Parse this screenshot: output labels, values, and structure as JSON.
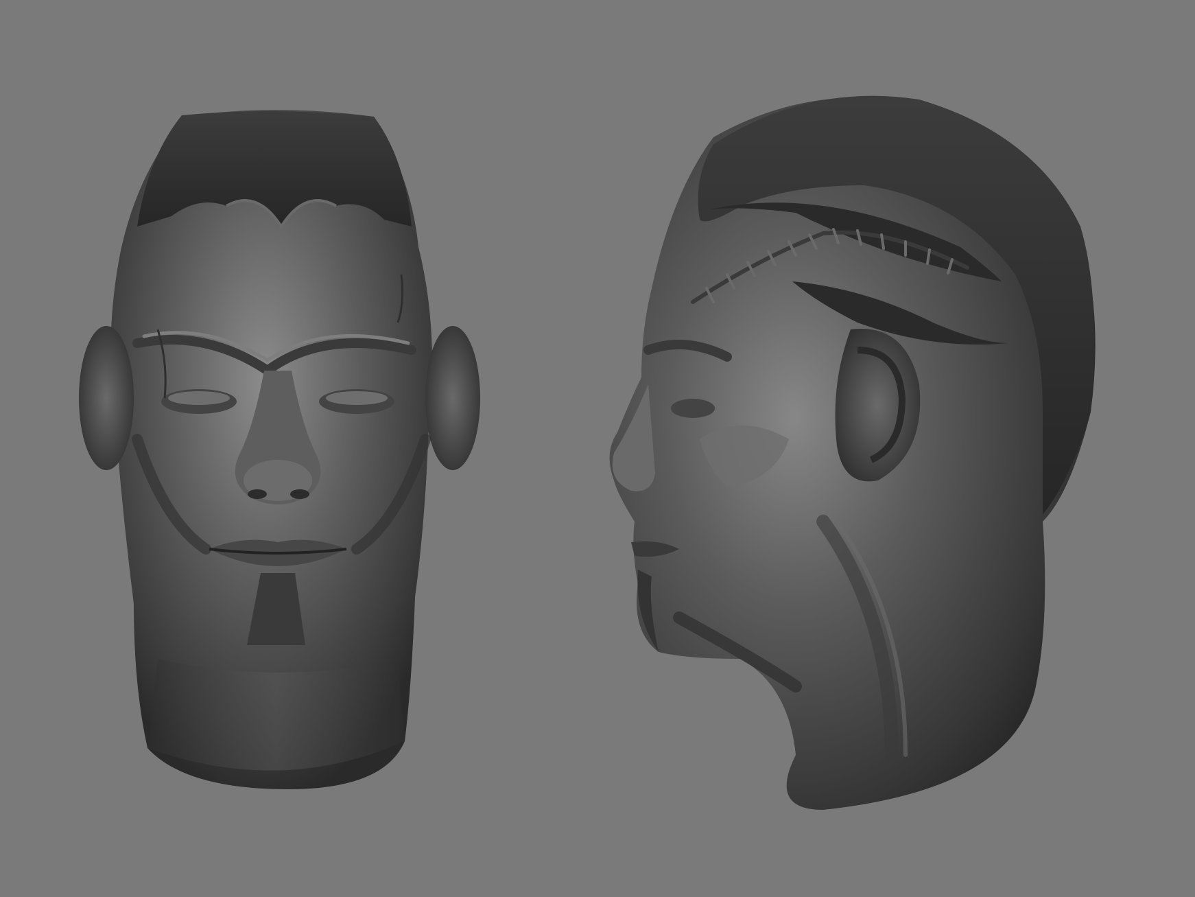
{
  "scene": {
    "background_color": "#7a7a7a",
    "material_base_color": "#4b4b4b",
    "material_highlight_color": "#9a9a9a",
    "material_shadow_color": "#262626",
    "subjects": [
      {
        "name": "sculpted-head-front-view"
      },
      {
        "name": "sculpted-head-side-view"
      }
    ]
  }
}
